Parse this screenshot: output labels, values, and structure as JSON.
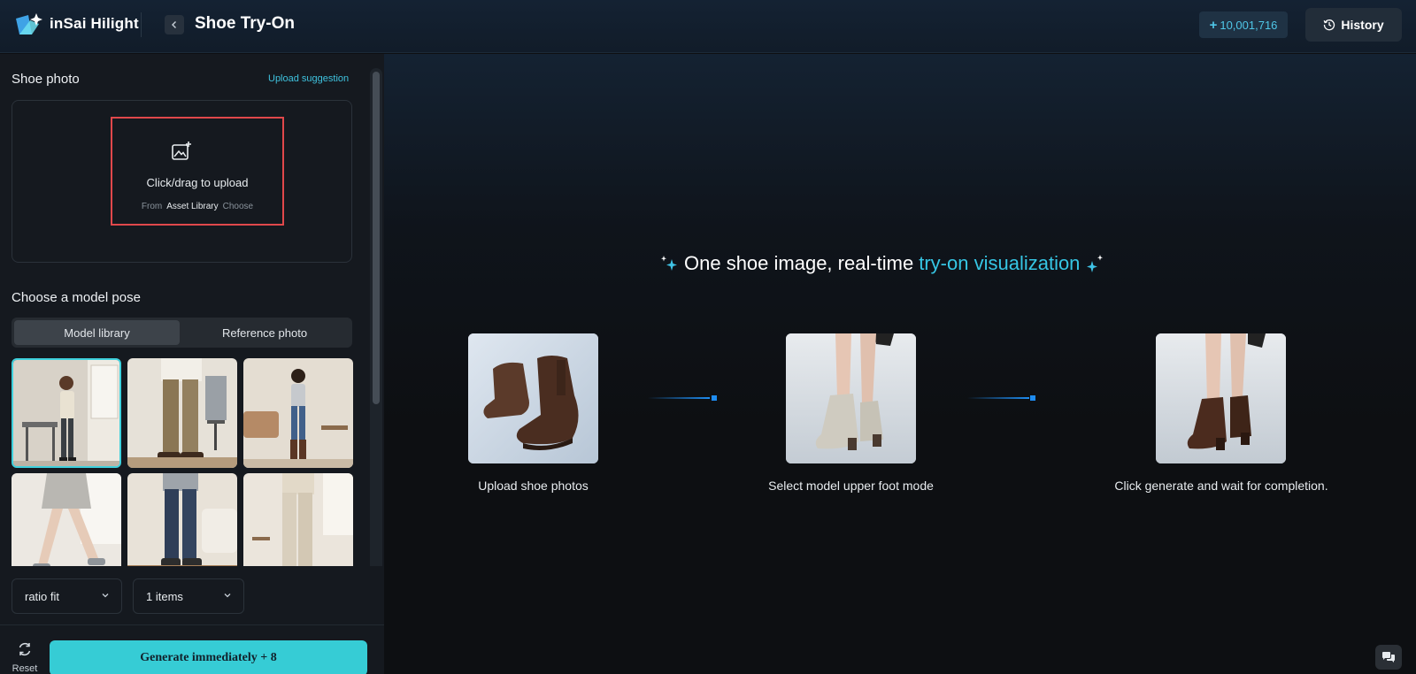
{
  "app": {
    "brand": "inSai Hilight",
    "title": "Shoe Try-On",
    "credits": "10,001,716",
    "history_label": "History"
  },
  "icons": {
    "logo": "star-logo-icon",
    "back": "chevron-left-icon",
    "credits": "plus-icon",
    "history": "clock-history-icon",
    "upload": "image-add-icon",
    "reset": "refresh-icon",
    "chat": "chat-bubbles-icon"
  },
  "sidebar": {
    "shoe_photo_title": "Shoe photo",
    "upload_suggestion": "Upload suggestion",
    "upload_text": "Click/drag to upload",
    "upload_from": "From",
    "upload_library": "Asset Library",
    "upload_choose": "Choose",
    "model_pose_title": "Choose a model pose",
    "tabs": [
      "Model library",
      "Reference photo"
    ],
    "active_tab": "Model library",
    "thumbnails": [
      "pose-1",
      "pose-2",
      "pose-3",
      "pose-4",
      "pose-5",
      "pose-6"
    ],
    "selected_thumbnail": "pose-1",
    "ratio_select": "ratio fit",
    "items_select": "1 items",
    "reset_label": "Reset",
    "generate_label": "Generate immediately",
    "generate_cost": "+ 8"
  },
  "main": {
    "hero_prefix": "One shoe image, real-time",
    "hero_accent": "try-on visualization",
    "steps": [
      {
        "label": "Upload shoe photos"
      },
      {
        "label": "Select model upper foot mode"
      },
      {
        "label": "Click generate and wait for completion."
      }
    ]
  },
  "colors": {
    "accent": "#36ccd5",
    "accent_text": "#36c6e4",
    "highlight_border": "#e0484b",
    "connector": "#1e8cf0"
  }
}
